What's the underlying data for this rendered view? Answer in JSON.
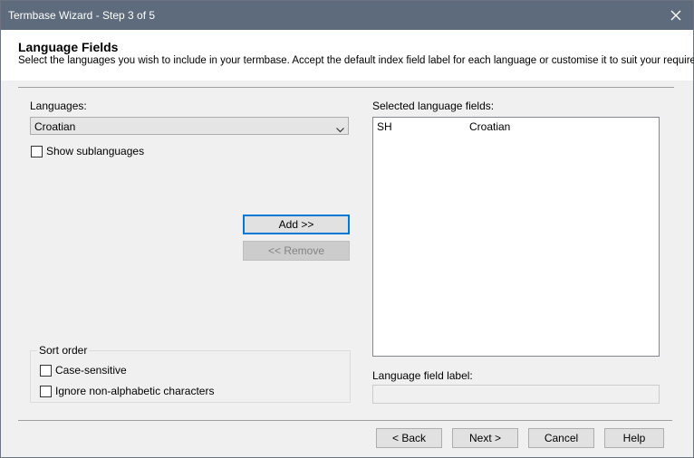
{
  "window": {
    "title": "Termbase Wizard - Step 3 of 5",
    "close_icon": "close-icon"
  },
  "header": {
    "title": "Language Fields",
    "description": "Select the languages you wish to include in your termbase. Accept the default index field label for each language or customise it to suit your requirements."
  },
  "languages": {
    "label": "Languages:",
    "selected": "Croatian",
    "show_sublanguages": {
      "label": "Show sublanguages",
      "checked": false
    }
  },
  "buttons": {
    "add": "Add >>",
    "remove": "<< Remove"
  },
  "sort_order": {
    "legend": "Sort order",
    "case_sensitive": {
      "label": "Case-sensitive",
      "checked": false
    },
    "ignore_non_alpha": {
      "label": "Ignore non-alphabetic characters",
      "checked": false
    }
  },
  "selected_fields": {
    "label": "Selected language fields:",
    "items": [
      {
        "code": "SH",
        "name": "Croatian"
      }
    ]
  },
  "field_label": {
    "label": "Language field label:",
    "value": ""
  },
  "footer": {
    "back": "< Back",
    "next": "Next >",
    "cancel": "Cancel",
    "help": "Help"
  },
  "colors": {
    "titlebar": "#5d6b7c",
    "dialog_bg": "#f0f0f0",
    "default_button_border": "#0078d7"
  }
}
